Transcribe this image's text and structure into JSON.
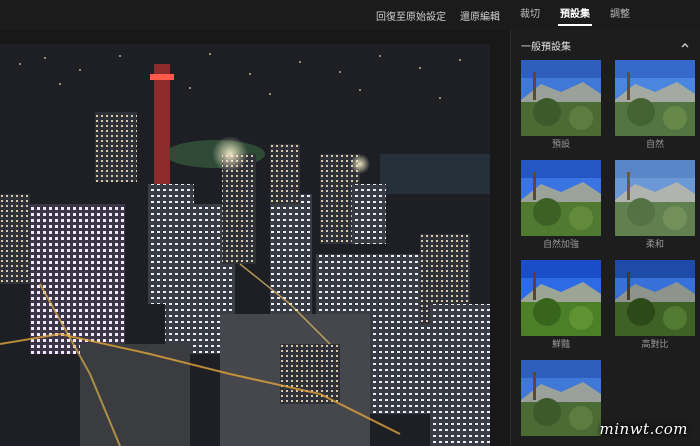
{
  "toolbar": {
    "revert_label": "回復至原始設定",
    "undo_label": "還原編輯"
  },
  "tabs": [
    {
      "label": "裁切",
      "active": false
    },
    {
      "label": "預設集",
      "active": true
    },
    {
      "label": "調整",
      "active": false
    }
  ],
  "sidebar": {
    "section_title": "一般預設集",
    "collapse_icon": "chevron-up-icon",
    "presets": [
      {
        "label": "預設"
      },
      {
        "label": "自然"
      },
      {
        "label": "自然加強"
      },
      {
        "label": "柔和"
      },
      {
        "label": "鮮豔"
      },
      {
        "label": "高對比"
      },
      {
        "label": ""
      }
    ]
  },
  "watermark": "minwt.com",
  "colors": {
    "background": "#161616",
    "sidebar": "#1d1d1d",
    "text": "#d8d8d8",
    "active_tab": "#ffffff"
  }
}
